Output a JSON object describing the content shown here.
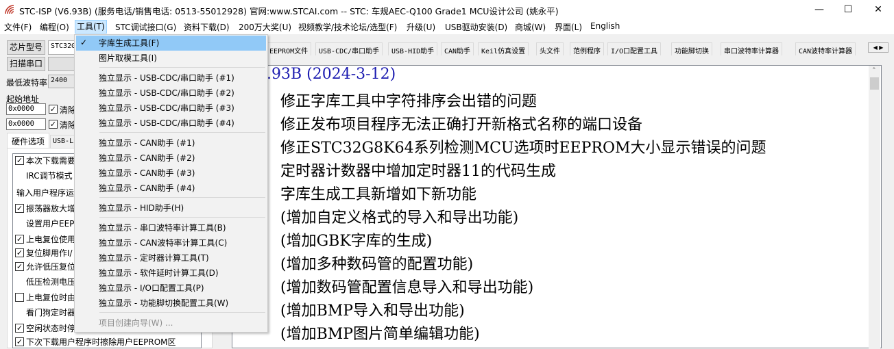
{
  "window": {
    "title": "STC-ISP (V6.93B) (服务电话/销售电话: 0513-55012928) 官网:www.STCAI.com  -- STC: 车规AEC-Q100 Grade1 MCU设计公司 (姚永平)",
    "minimize": "—",
    "maximize": "☐",
    "close": "✕"
  },
  "menubar": [
    "文件(F)",
    "编程(O)",
    "工具(T)",
    "STC调试接口(G)",
    "资料下载(D)",
    "200万大奖(U)",
    "视频教学/技术论坛/选型(F)",
    "升级(U)",
    "USB驱动安装(D)",
    "商城(W)",
    "界面(L)",
    "English"
  ],
  "left": {
    "chip_button": "芯片型号",
    "chip_value": "STC32G",
    "scan_button": "扫描串口",
    "baud_label": "最低波特率",
    "baud_value": "2400",
    "addr_label": "起始地址",
    "addr1": "0x0000",
    "addr2": "0x0000",
    "clear1": "清除",
    "clear2": "清除",
    "tabs": [
      "硬件选项",
      "USB-L"
    ],
    "options": [
      {
        "checked": true,
        "label": "本次下载需要"
      },
      {
        "checked": null,
        "label": "IRC调节模式"
      },
      {
        "checked": null,
        "label": "输入用户程序运"
      },
      {
        "checked": true,
        "label": "振荡器放大增"
      },
      {
        "checked": null,
        "label": "设置用户EEPI"
      },
      {
        "checked": true,
        "label": "上电复位使用"
      },
      {
        "checked": true,
        "label": "复位脚用作I/"
      },
      {
        "checked": true,
        "label": "允许低压复位"
      },
      {
        "checked": null,
        "label": "低压检测电压"
      },
      {
        "checked": false,
        "label": "上电复位时由"
      },
      {
        "checked": null,
        "label": "看门狗定时器"
      },
      {
        "checked": true,
        "label": "空闲状态时停"
      },
      {
        "checked": true,
        "label": "下次下载用户程序时擦除用户EEPROM区"
      }
    ]
  },
  "tabs": [
    "EEPROM文件",
    "USB-CDC/串口助手",
    "USB-HID助手",
    "CAN助手",
    "Keil仿真设置",
    "头文件",
    "范例程序",
    "I/O口配置工具",
    "功能脚切换",
    "串口波特率计算器",
    "CAN波特率计算器"
  ],
  "content": {
    "heading": ".93B (2024-3-12)",
    "lines": [
      "修正字库工具中字符排序会出错的问题",
      "修正发布项目程序无法正确打开新格式名称的端口设备",
      "修正STC32G8K64系列检测MCU选项时EEPROM大小显示错误的问题",
      "定时器计数器中增加定时器11的代码生成",
      "字库生成工具新增如下新功能",
      "(增加自定义格式的导入和导出功能)",
      "(增加GBK字库的生成)",
      "(增加多种数码管的配置功能)",
      "(增加数码管配置信息导入和导出功能)",
      "(增加BMP导入和导出功能)",
      "(增加BMP图片简单编辑功能)"
    ]
  },
  "tools_menu": {
    "items": [
      "字库生成工具(F)",
      "图片取模工具(I)",
      "独立显示 - USB-CDC/串口助手 (#1)",
      "独立显示 - USB-CDC/串口助手 (#2)",
      "独立显示 - USB-CDC/串口助手 (#3)",
      "独立显示 - USB-CDC/串口助手 (#4)",
      "独立显示 - CAN助手 (#1)",
      "独立显示 - CAN助手 (#2)",
      "独立显示 - CAN助手 (#3)",
      "独立显示 - CAN助手 (#4)",
      "独立显示 - HID助手(H)",
      "独立显示 - 串口波特率计算工具(B)",
      "独立显示 - CAN波特率计算工具(C)",
      "独立显示 - 定时器计算工具(T)",
      "独立显示 - 软件延时计算工具(D)",
      "独立显示 - I/O口配置工具(P)",
      "独立显示 - 功能脚切换配置工具(W)",
      "项目创建向导(W) ..."
    ],
    "checked_item": "字库生成工具(F)",
    "disabled_item": "项目创建向导(W) ..."
  },
  "colors": {
    "heading": "#1c1cb0",
    "highlight": "#91c9f7"
  }
}
